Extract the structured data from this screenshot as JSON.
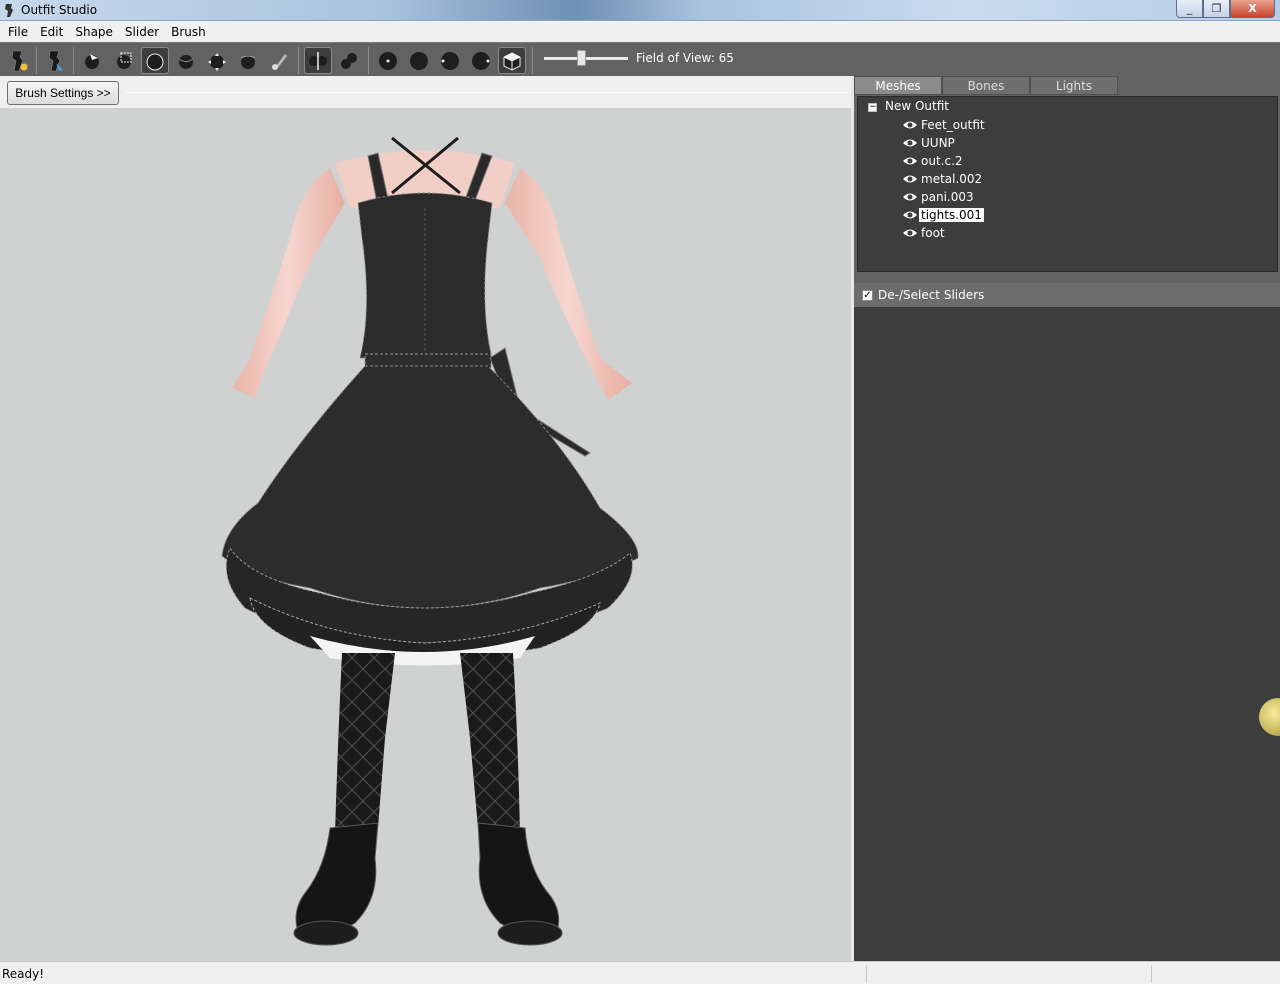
{
  "window": {
    "title": "Outfit Studio",
    "controls": {
      "minimize": "_",
      "maximize": "❐",
      "close": "X"
    }
  },
  "menu": [
    "File",
    "Edit",
    "Shape",
    "Slider",
    "Brush"
  ],
  "toolbar": {
    "fov_label": "Field of View: 65",
    "fov_value": 65
  },
  "brush": {
    "settings_label": "Brush Settings >>"
  },
  "tabs": [
    "Meshes",
    "Bones",
    "Lights"
  ],
  "active_tab": "Meshes",
  "tree": {
    "root": "New Outfit",
    "items": [
      "Feet_outfit",
      "UUNP",
      "out.c.2",
      "metal.002",
      "pani.003",
      "tights.001",
      "foot"
    ],
    "selected": "tights.001"
  },
  "sliders": {
    "header": "De-/Select Sliders",
    "checked": true
  },
  "status": {
    "text": "Ready!"
  }
}
